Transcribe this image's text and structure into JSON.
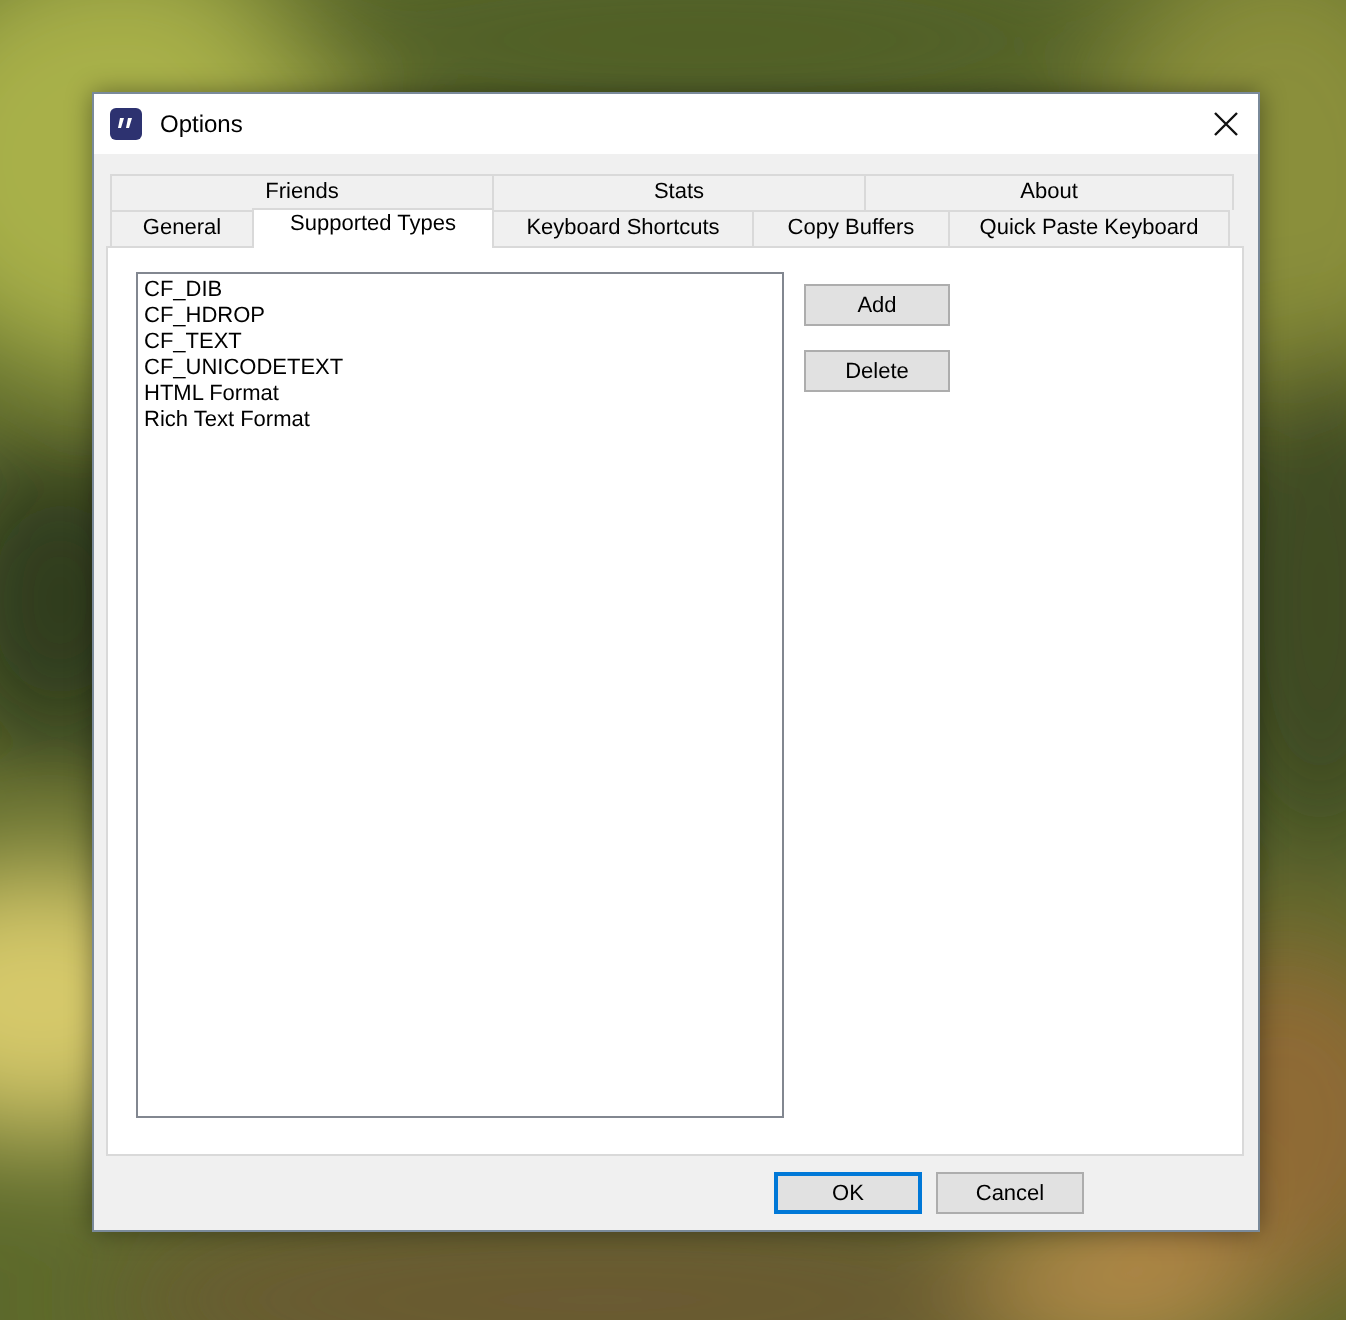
{
  "window": {
    "title": "Options"
  },
  "back_tabs": [
    {
      "label": "Friends",
      "selected": false
    },
    {
      "label": "Stats",
      "selected": false
    },
    {
      "label": "About",
      "selected": false
    }
  ],
  "front_tabs": [
    {
      "label": "General",
      "selected": false
    },
    {
      "label": "Supported Types",
      "selected": true
    },
    {
      "label": "Keyboard Shortcuts",
      "selected": false
    },
    {
      "label": "Copy Buffers",
      "selected": false
    },
    {
      "label": "Quick Paste Keyboard",
      "selected": false
    }
  ],
  "types_list": {
    "items": [
      "CF_DIB",
      "CF_HDROP",
      "CF_TEXT",
      "CF_UNICODETEXT",
      "HTML Format",
      "Rich Text Format"
    ]
  },
  "side_buttons": [
    "Add",
    "Delete"
  ],
  "buttons": [
    {
      "label": "OK",
      "default": true
    },
    {
      "label": "Cancel",
      "default": false
    }
  ]
}
